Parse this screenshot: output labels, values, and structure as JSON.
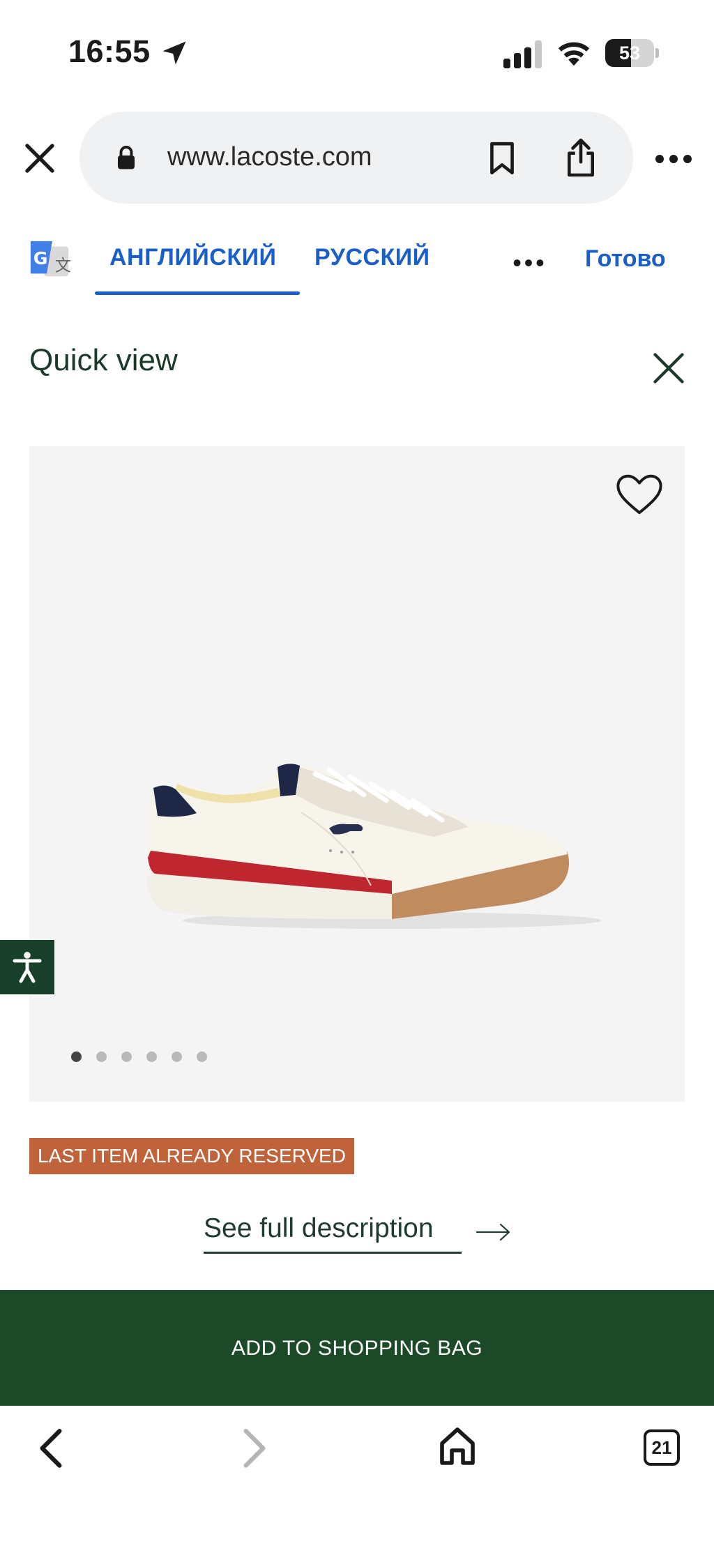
{
  "status_bar": {
    "time": "16:55",
    "battery": "53",
    "battery_level": 0.53,
    "icons": [
      "location-arrow-icon",
      "cellular-signal-icon",
      "wifi-icon",
      "battery-icon"
    ]
  },
  "browser": {
    "url": "www.lacoste.com",
    "icons": [
      "close-icon",
      "lock-icon",
      "bookmark-icon",
      "share-icon",
      "more-icon"
    ]
  },
  "translate_bar": {
    "source_lang": "АНГЛИЙСКИЙ",
    "target_lang": "РУССКИЙ",
    "done": "Готово",
    "active_tab": "source_lang",
    "accent_color": "#1a5fc9"
  },
  "quick_view": {
    "title": "Quick view"
  },
  "product": {
    "image_count": 6,
    "active_image": 1,
    "badge": "LAST ITEM ALREADY RESERVED",
    "badge_color": "#c1633a",
    "full_description_link": "See full description",
    "add_to_bag": "ADD TO SHOPPING BAG",
    "add_to_bag_color": "#1c4a29"
  },
  "toolbar": {
    "tabs_count": "21",
    "icons": [
      "back-icon",
      "forward-icon",
      "home-icon",
      "tabs-icon"
    ]
  }
}
